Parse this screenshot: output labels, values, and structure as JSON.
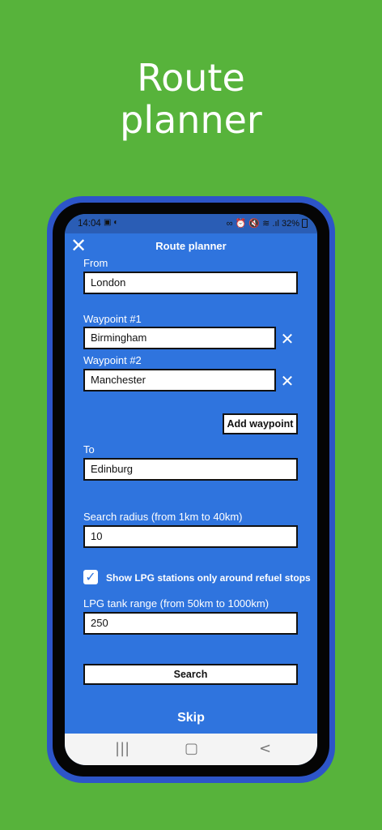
{
  "hero": {
    "title_line1": "Route",
    "title_line2": "planner"
  },
  "status_bar": {
    "time": "14:04",
    "left_icons": "▣ ◐",
    "right_icons": "∞ ⏰ 🔇 ≋ .ıl",
    "battery": "32%"
  },
  "app_bar": {
    "title": "Route planner",
    "close_icon": "close-icon"
  },
  "form": {
    "from_label": "From",
    "from_value": "London",
    "waypoints": [
      {
        "label": "Waypoint #1",
        "value": "Birmingham"
      },
      {
        "label": "Waypoint #2",
        "value": "Manchester"
      }
    ],
    "add_waypoint_label": "Add waypoint",
    "to_label": "To",
    "to_value": "Edinburg",
    "radius_label": "Search radius (from 1km to 40km)",
    "radius_value": "10",
    "checkbox_label": "Show LPG stations only around refuel stops",
    "checkbox_checked": true,
    "tank_label": "LPG tank range (from 50km to 1000km)",
    "tank_value": "250",
    "search_label": "Search",
    "skip_label": "Skip"
  },
  "nav_bar": {
    "recents_icon": "|||",
    "home_icon": "▢",
    "back_icon": "<"
  },
  "colors": {
    "background": "#57b33b",
    "screen": "#2f74de",
    "phone_frame": "#2d55c8"
  }
}
